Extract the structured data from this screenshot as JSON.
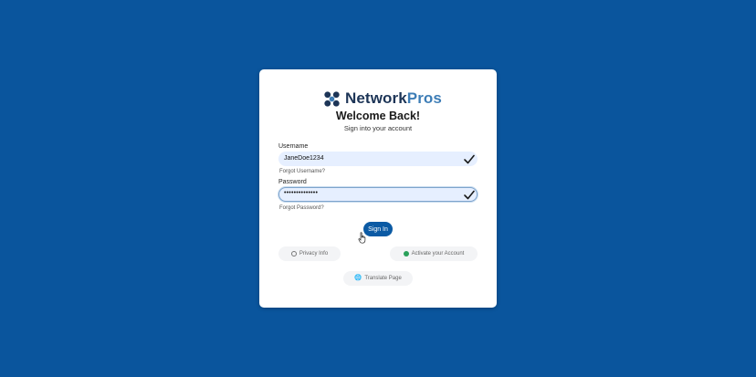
{
  "brand": {
    "name_part1": "Network",
    "name_part2": "Pros"
  },
  "header": {
    "title": "Welcome Back!",
    "subtitle": "Sign into your account"
  },
  "form": {
    "username_label": "Username",
    "username_value": "JaneDoe1234",
    "forgot_username": "Forgot Username?",
    "password_label": "Password",
    "password_value": "••••••••••••••",
    "forgot_password": "Forgot Password?",
    "sign_in_label": "Sign In"
  },
  "footer": {
    "privacy_label": "Privacy Info",
    "activate_label": "Activate your Account",
    "translate_label": "Translate Page"
  },
  "colors": {
    "background": "#0a559d",
    "primary_button": "#0b5aa4",
    "input_fill": "#e6efff",
    "activate_dot": "#2aa05a"
  },
  "icons": {
    "logo": "networkpros-logo-icon",
    "valid": "checkmark-icon",
    "privacy": "privacy-icon",
    "activate": "activate-dot-icon",
    "translate": "translate-icon",
    "pointer": "hand-pointer-cursor-icon"
  }
}
